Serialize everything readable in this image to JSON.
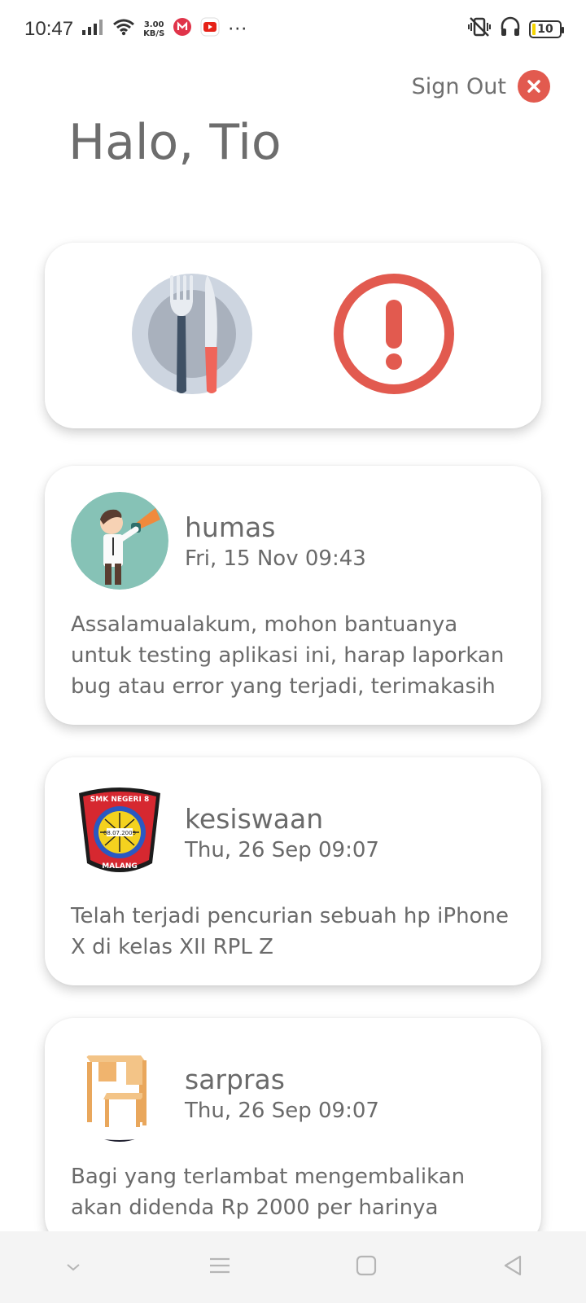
{
  "status_bar": {
    "time": "10:47",
    "net_speed_value": "3.00",
    "net_speed_unit": "KB/S",
    "more": "···",
    "battery": "10"
  },
  "header": {
    "sign_out_label": "Sign Out",
    "greeting": "Halo, Tio"
  },
  "menu": {
    "items": [
      {
        "icon": "plate-fork-knife-icon"
      },
      {
        "icon": "alert-circle-icon"
      }
    ]
  },
  "posts": [
    {
      "author": "humas",
      "date": "Fri, 15 Nov 09:43",
      "body": "Assalamualakum, mohon bantuanya untuk testing aplikasi ini, harap laporkan bug atau error yang terjadi, terimakasih",
      "avatar": "megaphone-man-avatar"
    },
    {
      "author": "kesiswaan",
      "date": "Thu, 26 Sep 09:07",
      "body": "Telah terjadi pencurian sebuah hp iPhone X di kelas XII RPL Z",
      "avatar": "school-logo-avatar",
      "logo_text_top": "SMK NEGERI 8",
      "logo_text_bottom": "MALANG",
      "logo_text_center": "08.07.2009"
    },
    {
      "author": "sarpras",
      "date": "Thu, 26 Sep 09:07",
      "body": "Bagi yang terlambat mengembalikan akan didenda Rp 2000 per harinya",
      "avatar": "desk-chair-avatar"
    }
  ],
  "colors": {
    "accent_red": "#e25a4f",
    "text_gray": "#6b6b6b",
    "nav_bg": "#f4f4f4"
  }
}
